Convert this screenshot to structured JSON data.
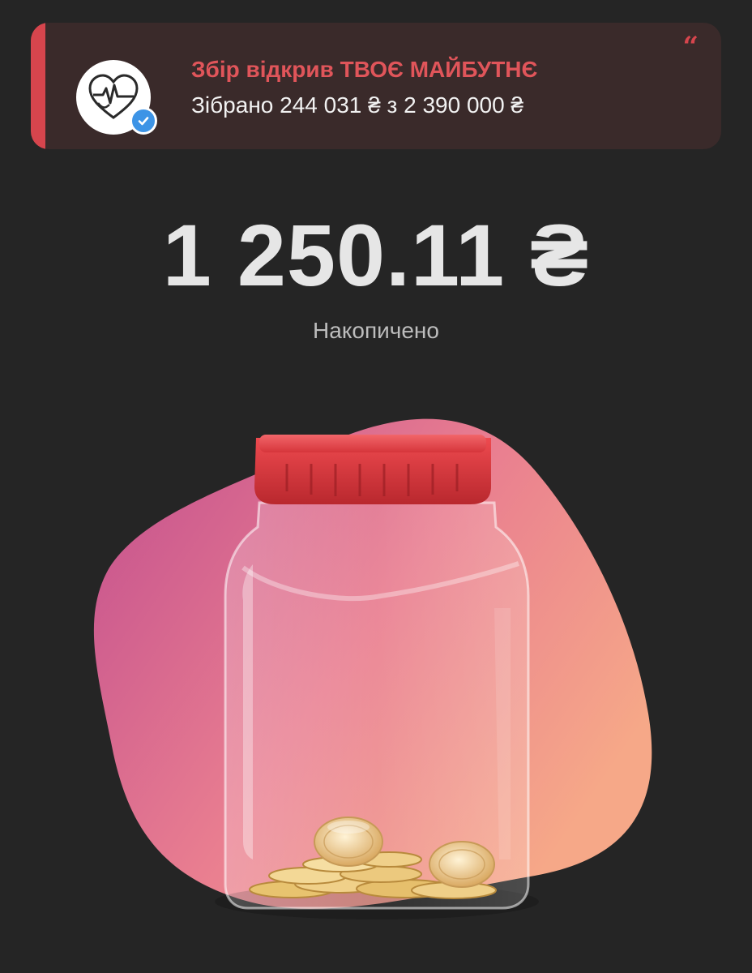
{
  "banner": {
    "title": "Збір відкрив ТВОЄ МАЙБУТНЄ",
    "subtitle": "Зібрано 244 031 ₴ з 2 390 000 ₴",
    "quote_icon": "quote-icon",
    "avatar_icon": "heart-logo-icon",
    "badge_icon": "verified-check-icon",
    "accent_color": "#d6454d"
  },
  "balance": {
    "amount": "1 250.11 ₴",
    "label": "Накопичено"
  },
  "jar": {
    "icon": "jar-illustration",
    "cap_color": "#d6454d"
  }
}
